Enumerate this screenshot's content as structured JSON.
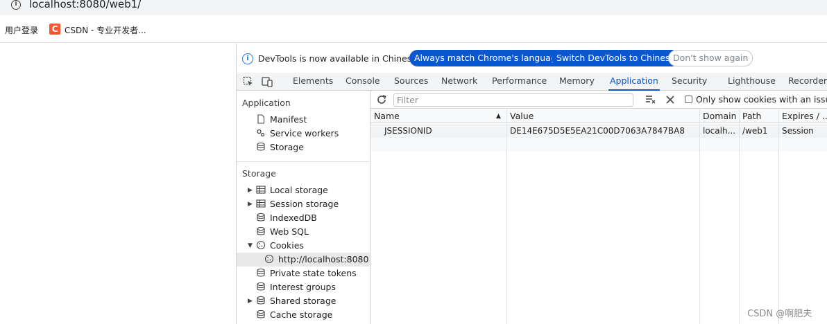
{
  "browser": {
    "url": "localhost:8080/web1/",
    "info_icon": "info-icon",
    "bookmarks": [
      {
        "label": "用户登录"
      },
      {
        "label": "CSDN - 专业开发者...",
        "icon": "csdn-icon",
        "icon_glyph": "C",
        "icon_color": "#fc5531"
      }
    ]
  },
  "devtools": {
    "infobar": {
      "message": "DevTools is now available in Chinese!",
      "match_button": "Always match Chrome's language",
      "switch_button": "Switch DevTools to Chinese",
      "dismiss_button": "Don't show again"
    },
    "tabs": [
      {
        "label": "Elements"
      },
      {
        "label": "Console"
      },
      {
        "label": "Sources"
      },
      {
        "label": "Network"
      },
      {
        "label": "Performance"
      },
      {
        "label": "Memory"
      },
      {
        "label": "Application",
        "active": true
      },
      {
        "label": "Security"
      },
      {
        "label": "Lighthouse"
      },
      {
        "label": "Recorder"
      }
    ],
    "accent_color": "#0b57d0",
    "sidebar": {
      "application_title": "Application",
      "application_items": [
        {
          "label": "Manifest",
          "icon": "file-icon"
        },
        {
          "label": "Service workers",
          "icon": "gears-icon"
        },
        {
          "label": "Storage",
          "icon": "database-icon"
        }
      ],
      "storage_title": "Storage",
      "storage_items": [
        {
          "label": "Local storage",
          "icon": "table-icon",
          "expandable": true
        },
        {
          "label": "Session storage",
          "icon": "table-icon",
          "expandable": true
        },
        {
          "label": "IndexedDB",
          "icon": "database-icon"
        },
        {
          "label": "Web SQL",
          "icon": "database-icon"
        },
        {
          "label": "Cookies",
          "icon": "cookie-icon",
          "expanded": true
        },
        {
          "label": "http://localhost:8080",
          "icon": "cookie-icon",
          "selected": true
        },
        {
          "label": "Private state tokens",
          "icon": "database-icon"
        },
        {
          "label": "Interest groups",
          "icon": "database-icon"
        },
        {
          "label": "Shared storage",
          "icon": "database-icon",
          "expandable": true
        },
        {
          "label": "Cache storage",
          "icon": "database-icon"
        }
      ]
    },
    "cookies": {
      "filter_placeholder": "Filter",
      "only_issue_label": "Only show cookies with an issue",
      "columns": [
        "Name",
        "Value",
        "Domain",
        "Path",
        "Expires / ..."
      ],
      "rows": [
        {
          "name": "JSESSIONID",
          "value": "DE14E675D5E5EA21C00D7063A7847BA8",
          "domain": "localh...",
          "path": "/web1",
          "expires": "Session"
        }
      ]
    }
  },
  "watermark": "CSDN @啊肥夫"
}
